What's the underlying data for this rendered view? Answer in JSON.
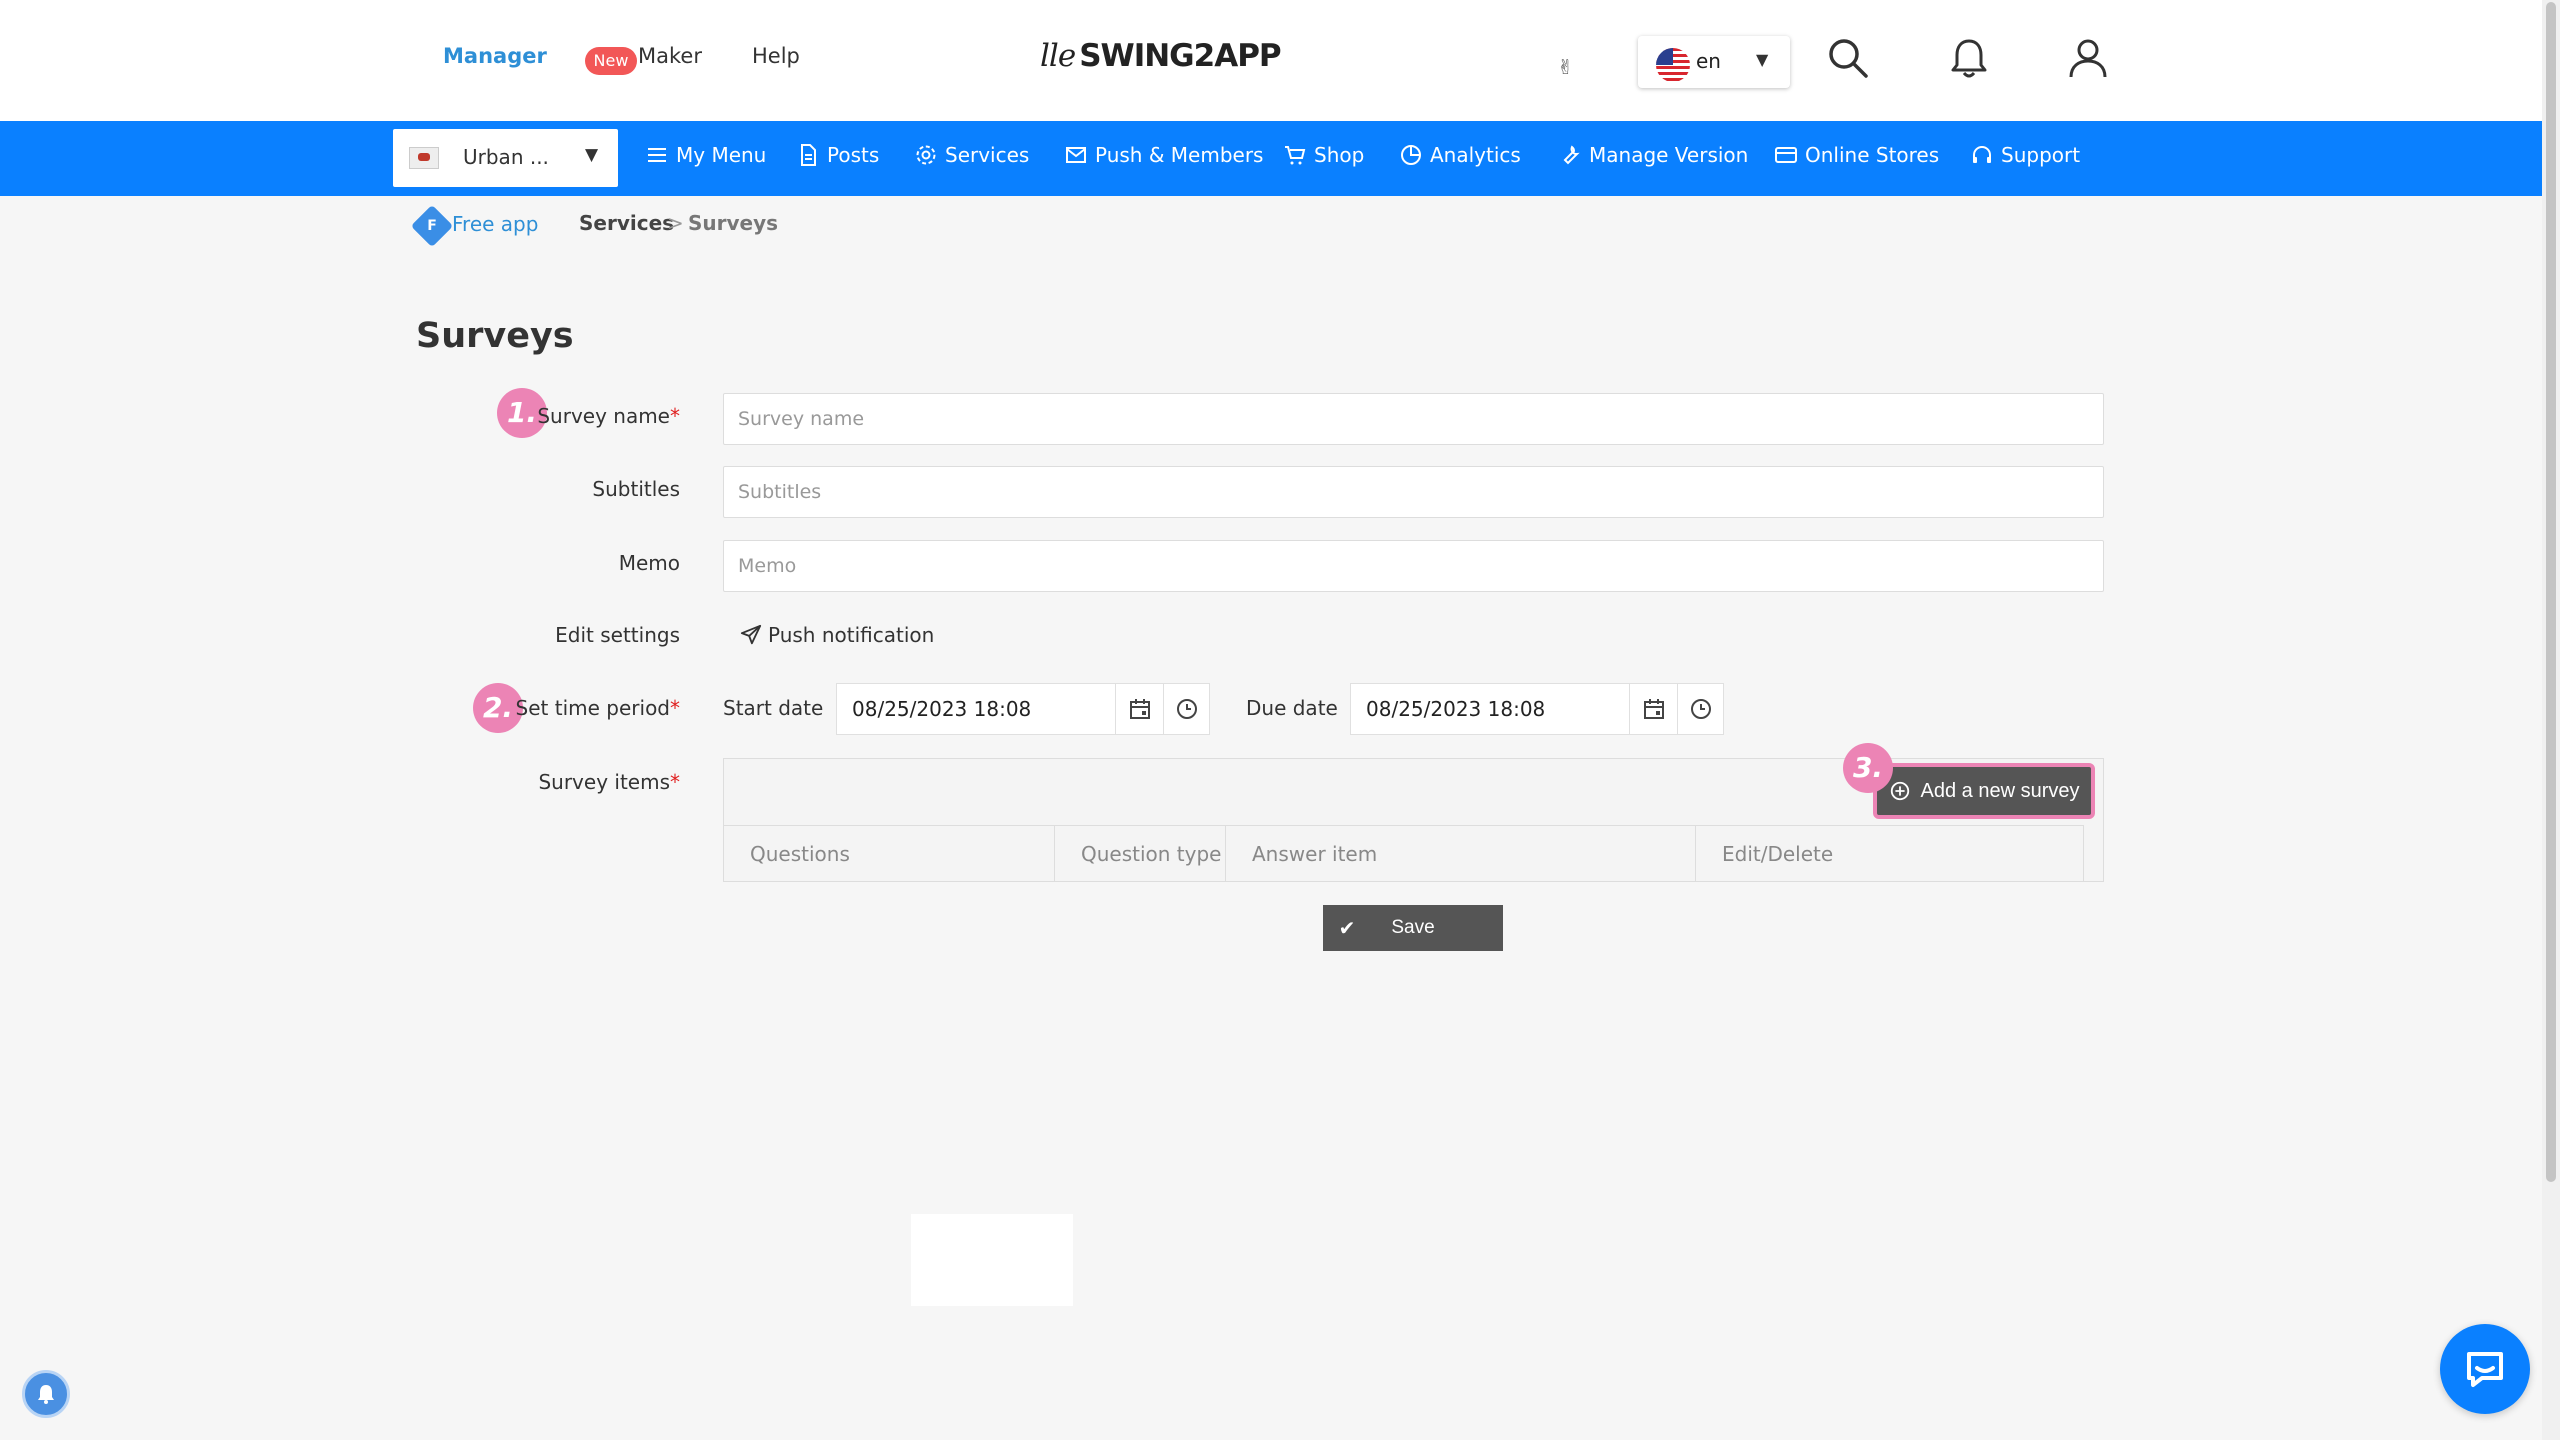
{
  "header": {
    "tabs": [
      {
        "label": "Manager",
        "active": true
      },
      {
        "label": "Maker",
        "badge": "New"
      },
      {
        "label": "Help"
      }
    ],
    "logo_mark": "lle",
    "logo_text": "SWING2APP",
    "language": {
      "flag": "us-flag",
      "code": "en"
    },
    "icons": [
      "search-icon",
      "bell-icon",
      "user-icon"
    ]
  },
  "nav": {
    "app_selector": "Urban ...",
    "items": [
      {
        "label": "My Menu",
        "icon": "menu-icon"
      },
      {
        "label": "Posts",
        "icon": "document-icon"
      },
      {
        "label": "Services",
        "icon": "gear-icon"
      },
      {
        "label": "Push & Members",
        "icon": "mail-icon"
      },
      {
        "label": "Shop",
        "icon": "cart-icon"
      },
      {
        "label": "Analytics",
        "icon": "pie-chart-icon"
      },
      {
        "label": "Manage Version",
        "icon": "wrench-icon"
      },
      {
        "label": "Online Stores",
        "icon": "card-icon"
      },
      {
        "label": "Support",
        "icon": "headset-icon"
      }
    ],
    "accent": "#0a80ff"
  },
  "breadcrumb": {
    "badge": "F",
    "plan": "Free app",
    "section": "Services",
    "separator": ">",
    "current": "Surveys"
  },
  "form": {
    "title": "Surveys",
    "required_mark": "*",
    "survey_name": {
      "step": "1.",
      "label": "Survey name",
      "placeholder": "Survey name",
      "value": ""
    },
    "subtitles": {
      "label": "Subtitles",
      "placeholder": "Subtitles",
      "value": ""
    },
    "memo": {
      "label": "Memo",
      "placeholder": "Memo",
      "value": ""
    },
    "edit_settings": {
      "label": "Edit settings",
      "option": "Push notification"
    },
    "time_period": {
      "step": "2.",
      "label": "Set time period",
      "start_label": "Start date",
      "start_value": "08/25/2023 18:08",
      "due_label": "Due date",
      "due_value": "08/25/2023 18:08"
    },
    "survey_items": {
      "label": "Survey items",
      "step": "3.",
      "add_button": "Add a new survey",
      "columns": [
        "Questions",
        "Question type",
        "Answer item",
        "Edit/Delete"
      ]
    },
    "save_button": "Save"
  },
  "colors": {
    "highlight": "#ec84b5",
    "link": "#2e8fd6",
    "required": "#e02020",
    "button_dark": "#555555"
  }
}
